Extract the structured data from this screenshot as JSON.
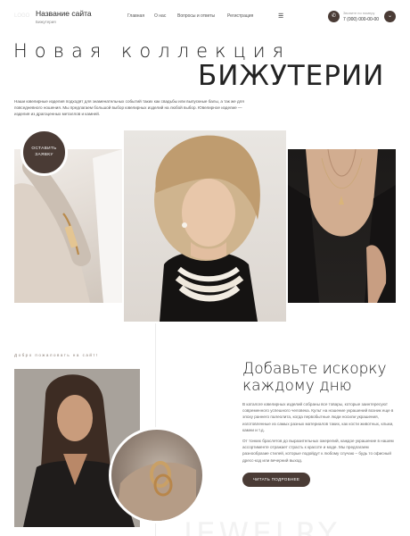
{
  "header": {
    "logo_text": "LOGO",
    "site_name": "Название сайта",
    "site_subtitle": "Бижутерия",
    "nav": [
      "Главная",
      "О нас",
      "Вопросы и ответы",
      "Регистрация"
    ],
    "menu_icon": "hamburger-icon",
    "phone_label": "Звоните по номеру",
    "phone": "7 (000) 000-00-00"
  },
  "hero": {
    "line1": "Новая коллекция",
    "line2": "БИЖУТЕРИИ",
    "description": "Наши ювелирные изделия подходят для знаменательных событий таких как свадьбы или выпускные балы, а так же для повседневного ношения. Мы предлагаем большой выбор ювелирных изделий на любой выбор. Ювелирное изделие — изделия из драгоценных металлов и камней.",
    "cta": "ОСТАВИТЬ ЗАЯВКУ"
  },
  "about": {
    "welcome": "Добро пожаловать на сайт!",
    "title": "Добавьте искорку каждому дню",
    "p1": "В каталоге ювелирных изделий собраны все товары, которые заинтересуют современного успешного человека. Культ на ношение украшений возник еще в эпоху раннего палеолита, когда первобытные люди носили украшения, изготовленные из самых разных материалов таких, как кости животных, клыки, камни и т.д.",
    "p2": "От тонких браслетов до выразительных ожерелий, каждое украшение в нашем ассортименте отражает страсть к красоте и моде. Мы предлагаем разнообразие стилей, которые подойдут к любому случаю – будь то офисный дресс-код или вечерний выход.",
    "button": "ЧИТАТЬ ПОДРОБНЕЕ",
    "watermark": "JEWELRY"
  },
  "colors": {
    "accent": "#4a3b35",
    "text": "#222222",
    "muted": "#666666"
  }
}
